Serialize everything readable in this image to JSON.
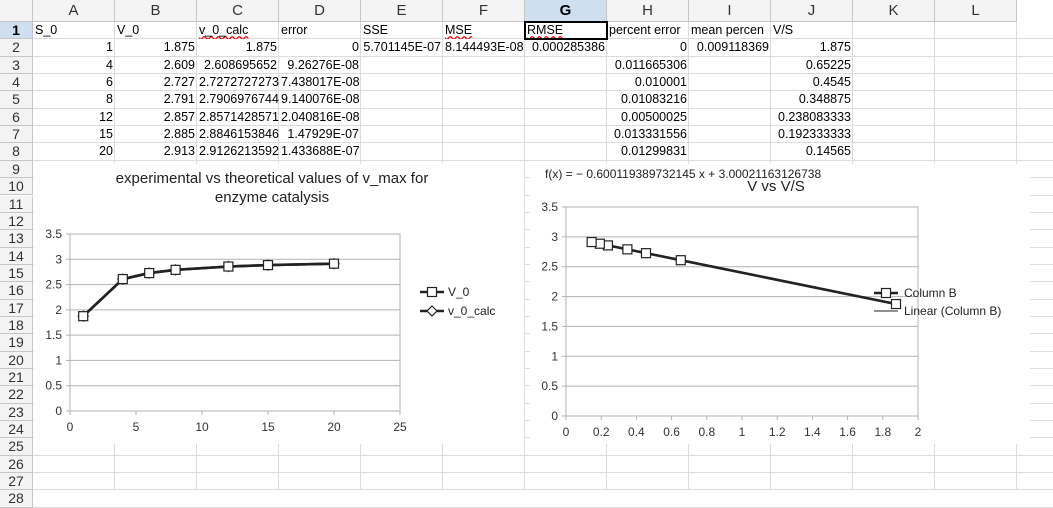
{
  "spreadsheet": {
    "columns": [
      "A",
      "B",
      "C",
      "D",
      "E",
      "F",
      "G",
      "H",
      "I",
      "J",
      "K",
      "L"
    ],
    "selected_column": "G",
    "rows": [
      "1",
      "2",
      "3",
      "4",
      "5",
      "6",
      "7",
      "8",
      "9",
      "10",
      "11",
      "12",
      "13",
      "14",
      "15",
      "16",
      "17",
      "18",
      "19",
      "20",
      "21",
      "22",
      "23",
      "24",
      "25",
      "26",
      "27",
      "28"
    ],
    "selected_row": "1",
    "header_row": [
      "S_0",
      "V_0",
      "v_0_calc",
      "error",
      "SSE",
      "MSE",
      "RMSE",
      "percent error",
      "mean percen",
      "V/S",
      "",
      ""
    ],
    "data_rows": [
      [
        "1",
        "1.875",
        "1.875",
        "0",
        "5.701145E-07",
        "8.144493E-08",
        "0.000285386",
        "0",
        "0.009118369",
        "1.875"
      ],
      [
        "4",
        "2.609",
        "2.608695652",
        "9.26276E-08",
        "",
        "",
        "",
        "0.011665306",
        "",
        "0.65225"
      ],
      [
        "6",
        "2.727",
        "2.7272727273",
        "7.438017E-08",
        "",
        "",
        "",
        "0.010001",
        "",
        "0.4545"
      ],
      [
        "8",
        "2.791",
        "2.7906976744",
        "9.140076E-08",
        "",
        "",
        "",
        "0.01083216",
        "",
        "0.348875"
      ],
      [
        "12",
        "2.857",
        "2.8571428571",
        "2.040816E-08",
        "",
        "",
        "",
        "0.00500025",
        "",
        "0.238083333"
      ],
      [
        "15",
        "2.885",
        "2.8846153846",
        "1.47929E-07",
        "",
        "",
        "",
        "0.013331556",
        "",
        "0.192333333"
      ],
      [
        "20",
        "2.913",
        "2.9126213592",
        "1.433688E-07",
        "",
        "",
        "",
        "0.01299831",
        "",
        "0.14565"
      ]
    ]
  },
  "chart_data": [
    {
      "type": "line",
      "title": "experimental vs theoretical values of v_max for enzyme catalysis",
      "title_line1": "experimental vs theoretical values of v_max for",
      "title_line2": "enzyme catalysis",
      "x": [
        1,
        4,
        6,
        8,
        12,
        15,
        20
      ],
      "series": [
        {
          "name": "V_0",
          "values": [
            1.875,
            2.609,
            2.727,
            2.791,
            2.857,
            2.885,
            2.913
          ]
        },
        {
          "name": "v_0_calc",
          "values": [
            1.875,
            2.6087,
            2.7273,
            2.7907,
            2.8571,
            2.8846,
            2.9126
          ]
        }
      ],
      "xlim": [
        0,
        25
      ],
      "ylim": [
        0,
        3.5
      ],
      "xticks": [
        "0",
        "5",
        "10",
        "15",
        "20",
        "25"
      ],
      "yticks": [
        "0",
        "0.5",
        "1",
        "1.5",
        "2",
        "2.5",
        "3",
        "3.5"
      ],
      "grid": true,
      "legend_position": "right"
    },
    {
      "type": "scatter",
      "title": "V vs V/S",
      "equation": "f(x) = − 0.600119389732145 x + 3.00021163126738",
      "x": [
        1.875,
        0.65225,
        0.4545,
        0.348875,
        0.238083,
        0.192333,
        0.14565
      ],
      "series": [
        {
          "name": "Column B",
          "values": [
            1.875,
            2.609,
            2.727,
            2.791,
            2.857,
            2.885,
            2.913
          ]
        }
      ],
      "trendline": {
        "name": "Linear (Column B)",
        "slope": -0.600119389732145,
        "intercept": 3.00021163126738
      },
      "xlim": [
        0,
        2
      ],
      "ylim": [
        0,
        3.5
      ],
      "xticks": [
        "0",
        "0.2",
        "0.4",
        "0.6",
        "0.8",
        "1",
        "1.2",
        "1.4",
        "1.6",
        "1.8",
        "2"
      ],
      "yticks": [
        "0",
        "0.5",
        "1",
        "1.5",
        "2",
        "2.5",
        "3",
        "3.5"
      ],
      "grid": true,
      "legend_position": "right"
    }
  ]
}
